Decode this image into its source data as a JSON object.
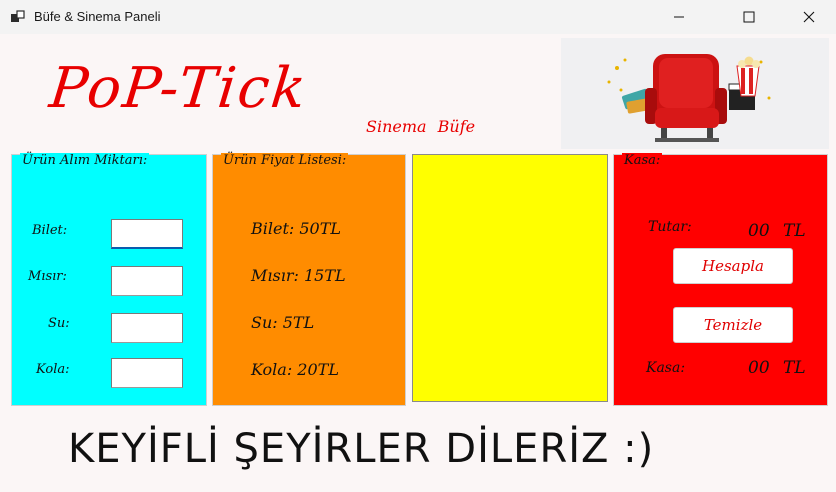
{
  "window": {
    "title": "Büfe & Sinema Paneli",
    "controls": {
      "minimize": "—",
      "maximize": "☐",
      "close": "✕"
    }
  },
  "header": {
    "logo": "PoP-Tick",
    "subtitle": "Sinema Büfe",
    "hero_image": "cinema-seat-popcorn-image"
  },
  "quantity_panel": {
    "title": "Ürün Alım Miktarı:",
    "color": "#00ffff",
    "items": [
      {
        "label": "Bilet:",
        "value": ""
      },
      {
        "label": "Mısır:",
        "value": ""
      },
      {
        "label": "Su:",
        "value": ""
      },
      {
        "label": "Kola:",
        "value": ""
      }
    ]
  },
  "price_panel": {
    "title": "Ürün Fiyat Listesi:",
    "color": "#ff8c00",
    "items": [
      "Bilet: 50TL",
      "Mısır: 15TL",
      "Su: 5TL",
      "Kola: 20TL"
    ]
  },
  "receipt_panel": {
    "color": "#ffff00",
    "text": ""
  },
  "kasa_panel": {
    "title": "Kasa:",
    "color": "#ff0000",
    "tutar_label": "Tutar:",
    "tutar_value": "00 TL",
    "hesapla_label": "Hesapla",
    "temizle_label": "Temizle",
    "kasa_label": "Kasa:",
    "kasa_value": "00 TL"
  },
  "footer": {
    "text": "KEYİFLİ ŞEYİRLER DİLERİZ :)"
  }
}
